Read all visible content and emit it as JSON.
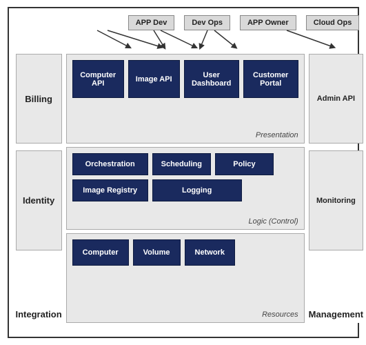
{
  "roles": [
    "APP Dev",
    "Dev Ops",
    "APP Owner",
    "Cloud Ops"
  ],
  "left": {
    "billing": "Billing",
    "identity": "Identity",
    "integration": "Integration"
  },
  "right": {
    "admin": "Admin API",
    "monitoring": "Monitoring",
    "management": "Management"
  },
  "presentation": {
    "label": "Presentation",
    "buttons": [
      "Computer API",
      "Image API",
      "User Dashboard",
      "Customer Portal"
    ]
  },
  "logic": {
    "label": "Logic (Control)",
    "row1": [
      "Orchestration",
      "Scheduling",
      "Policy"
    ],
    "row2": [
      "Image Registry",
      "Logging"
    ]
  },
  "resources": {
    "label": "Resources",
    "buttons": [
      "Computer",
      "Volume",
      "Network"
    ]
  }
}
